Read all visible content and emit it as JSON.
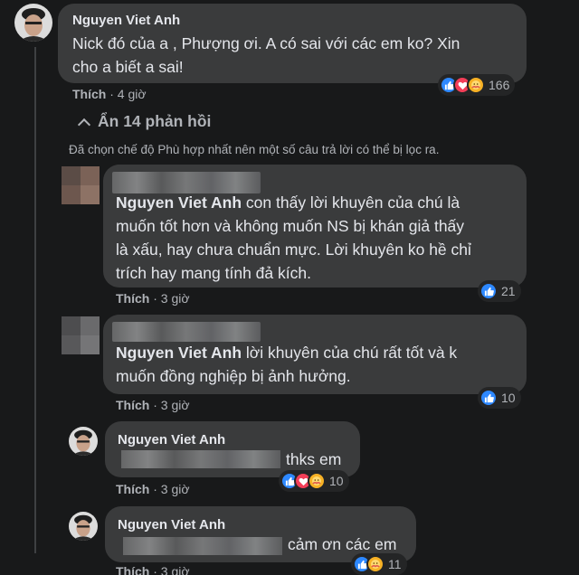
{
  "comments": [
    {
      "author": "Nguyen Viet Anh",
      "text_lines": [
        "Nick đó của a , Phượng ơi. A có sai với các em ko? Xin",
        "cho a biết a sai!"
      ],
      "like_label": "Thích",
      "time": "4 giờ",
      "reactions": [
        "like",
        "love",
        "care"
      ],
      "reaction_count": "166"
    }
  ],
  "replies_toggle": {
    "arrow": "⌃",
    "label": "Ẩn 14 phản hồi"
  },
  "filter_notice": "Đã chọn chế độ Phù hợp nhất nên một số câu trả lời có thể bị lọc ra.",
  "replies": [
    {
      "mention": "Nguyen Viet Anh",
      "text_lines": [
        "con thấy lời khuyên của chú là",
        "muốn tốt hơn và không muốn NS bị khán giả thấy",
        "là xấu, hay chưa chuẩn mực. Lời khuyên ko hề chỉ",
        "trích hay mang tính đả kích."
      ],
      "first_line_rest": " con thấy lời khuyên của chú là",
      "like_label": "Thích",
      "time": "3 giờ",
      "reaction_count": "21"
    },
    {
      "mention": "Nguyen Viet Anh",
      "first_line_rest": " lời khuyên của chú rất tốt và k",
      "second_line": "muốn đồng nghiệp bị ảnh hưởng.",
      "like_label": "Thích",
      "time": "3 giờ",
      "reaction_count": "10"
    },
    {
      "author": "Nguyen Viet Anh",
      "text_tail": "thks em",
      "like_label": "Thích",
      "time": "3 giờ",
      "reaction_count": "10"
    },
    {
      "author": "Nguyen Viet Anh",
      "text_tail": "cảm ơn các em",
      "like_label": "Thích",
      "time": "3 giờ",
      "reaction_count": "11"
    }
  ],
  "colors": {
    "background": "#18191a",
    "bubble": "#3a3b3c",
    "secondary_text": "#b0b3b8",
    "like_blue": "#2d88ff",
    "love_red": "#f33e58",
    "care_yellow": "#f7b125"
  }
}
